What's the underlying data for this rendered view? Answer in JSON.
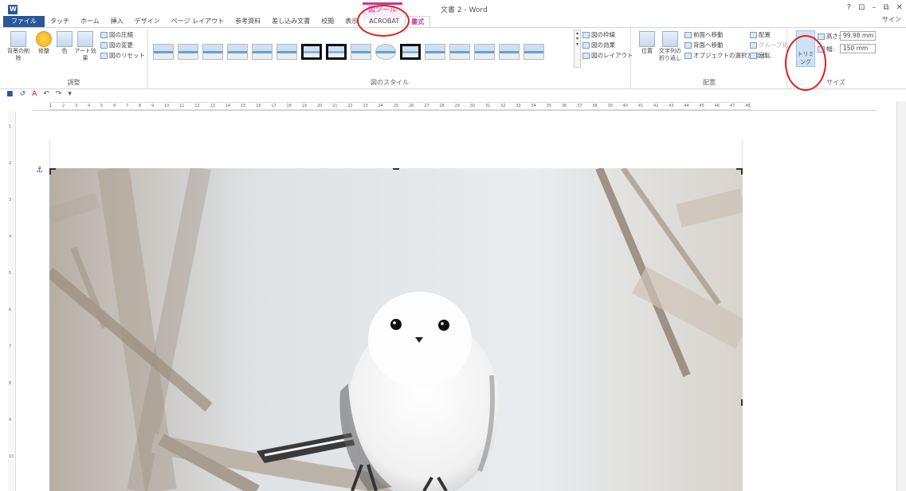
{
  "app": {
    "logo_icon": "word-logo-icon",
    "context_group": "図ツール",
    "doc_title": "文書 2 - Word",
    "window_controls": [
      "?",
      "⊡",
      "–",
      "⧉",
      "✕"
    ],
    "signin": "サイン"
  },
  "tabs": {
    "file": "ファイル",
    "touch": "タッチ",
    "home": "ホーム",
    "insert": "挿入",
    "design": "デザイン",
    "page_layout": "ページ レイアウト",
    "references": "参考資料",
    "mailings": "差し込み文書",
    "review": "校閲",
    "view": "表示",
    "acrobat": "ACROBAT",
    "format": "書式"
  },
  "ribbon": {
    "adjust": {
      "label": "調整",
      "remove_bg": "背景の削除",
      "corrections": "修整",
      "color": "色",
      "art_effects": "アート効果",
      "compress": "図の圧縮",
      "change": "図の変更",
      "reset": "図のリセット"
    },
    "styles": {
      "label": "図のスタイル",
      "border": "図の枠線",
      "effects": "図の効果",
      "layout": "図のレイアウト"
    },
    "arrange": {
      "label": "配置",
      "position": "位置",
      "wrap": "文字列の折り返し",
      "forward": "前面へ移動",
      "backward": "背面へ移動",
      "selection": "オブジェクトの選択と表示",
      "align": "配置",
      "group": "グループ化",
      "rotate": "回転"
    },
    "size": {
      "label": "サイズ",
      "crop": "トリミング",
      "height_label": "高さ:",
      "height": "99.98 mm",
      "width_label": "幅:",
      "width": "150 mm"
    }
  },
  "ruler": {
    "marks": [
      "1",
      "2",
      "3",
      "4",
      "5",
      "6",
      "7",
      "8",
      "9",
      "10",
      "11",
      "12",
      "13",
      "14",
      "15",
      "16",
      "17",
      "18",
      "19",
      "20",
      "21",
      "22",
      "23",
      "24",
      "25",
      "26",
      "27",
      "28",
      "29",
      "30",
      "31",
      "32",
      "33",
      "34",
      "35",
      "36",
      "37",
      "38",
      "39",
      "40",
      "41",
      "42",
      "43",
      "44",
      "45",
      "46",
      "47",
      "48"
    ]
  },
  "vruler": {
    "marks": [
      "1",
      "2",
      "3",
      "4",
      "5",
      "6",
      "7",
      "8",
      "9",
      "10"
    ]
  },
  "colors": {
    "accent": "#2b579a",
    "context": "#c0399e",
    "annotation": "#e2211c"
  },
  "document": {
    "image": "long-tailed-tit-photo",
    "anchor_icon": "anchor-icon"
  }
}
